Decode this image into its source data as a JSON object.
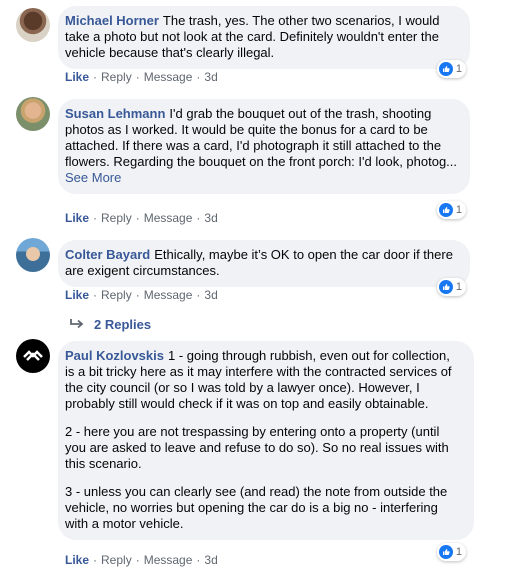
{
  "comments": [
    {
      "author": "Michael Horner",
      "paragraphs": [
        "The trash, yes. The other two scenarios, I would take a photo but not look at the card. Definitely wouldn't enter the vehicle because that's clearly illegal."
      ],
      "see_more": "",
      "actions": {
        "like": "Like",
        "reply": "Reply",
        "message": "Message",
        "time": "3d"
      },
      "reaction_count": "1"
    },
    {
      "author": "Susan Lehmann",
      "paragraphs": [
        "I'd grab the bouquet out of the trash, shooting photos as I worked. It would be quite the bonus for a card to be attached. If there was a card, I'd photograph it still attached to the flowers. Regarding the bouquet on the front porch: I'd look, photog..."
      ],
      "see_more": "See More",
      "actions": {
        "like": "Like",
        "reply": "Reply",
        "message": "Message",
        "time": "3d"
      },
      "reaction_count": "1"
    },
    {
      "author": "Colter Bayard",
      "paragraphs": [
        "Ethically, maybe it’s OK to open the car door if there are exigent circumstances."
      ],
      "see_more": "",
      "actions": {
        "like": "Like",
        "reply": "Reply",
        "message": "Message",
        "time": "3d"
      },
      "reaction_count": "1",
      "replies_label": "2 Replies"
    },
    {
      "author": "Paul Kozlovskis",
      "paragraphs": [
        "1 - going through rubbish, even out for collection, is a bit tricky here as it may interfere with the contracted services of the city council (or so I was told by a lawyer once). However, I probably still would check if it was on top and easily obtainable.",
        "2 - here you are not trespassing by entering onto a property (until you are asked to leave and refuse to do so). So no real issues with this scenario.",
        "3 - unless you can clearly see (and read) the note from outside the vehicle, no worries but opening the car do is a big no - interfering with a motor vehicle."
      ],
      "see_more": "",
      "actions": {
        "like": "Like",
        "reply": "Reply",
        "message": "Message",
        "time": "3d"
      },
      "reaction_count": "1"
    }
  ],
  "colors": {
    "link": "#385898",
    "bubble": "#f0f2f5",
    "like_blue": "#1877f2"
  },
  "icons": [
    "like-thumb-icon",
    "reply-arrow-icon"
  ]
}
